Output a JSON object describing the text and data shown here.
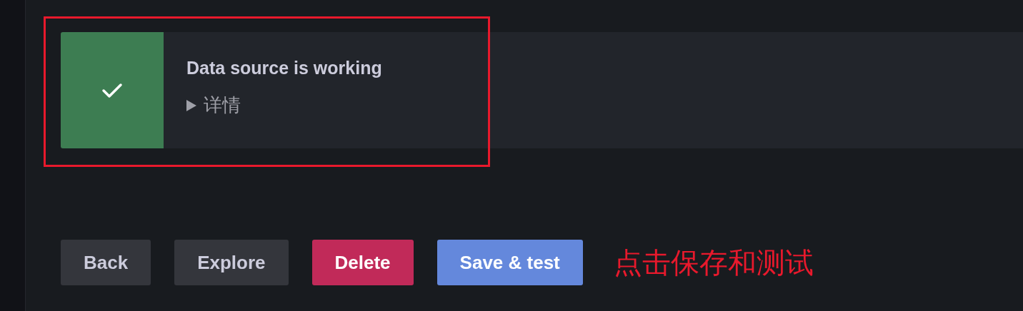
{
  "alert": {
    "kind": "success",
    "title": "Data source is working",
    "details": {
      "label": "详情",
      "expanded": false
    }
  },
  "buttons": [
    {
      "label": "Back",
      "kind": "secondary"
    },
    {
      "label": "Explore",
      "kind": "secondary"
    },
    {
      "label": "Delete",
      "kind": "destructive"
    },
    {
      "label": "Save & test",
      "kind": "primary"
    }
  ],
  "annotation": {
    "text": "点击保存和测试"
  }
}
